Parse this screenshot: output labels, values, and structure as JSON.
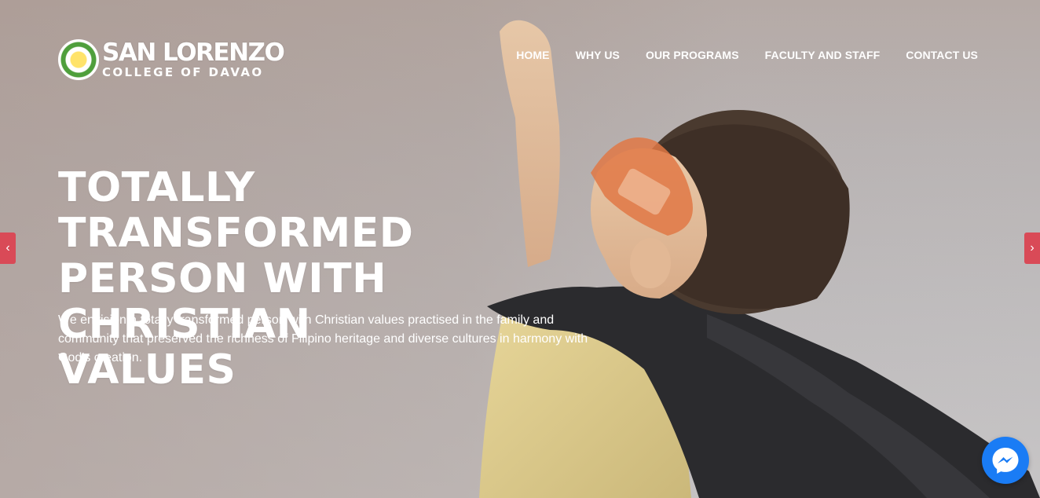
{
  "brand": {
    "line1": "SAN LORENZO",
    "line2": "COLLEGE OF DAVAO"
  },
  "nav": {
    "items": [
      "HOME",
      "WHY US",
      "OUR PROGRAMS",
      "FACULTY AND STAFF",
      "CONTACT US"
    ]
  },
  "hero": {
    "headline_lines": [
      "TOTALLY TRANSFORMED",
      "PERSON WITH CHRISTIAN",
      "VALUES"
    ],
    "subtext": "We envision a totally transformed person with Christian values practised in the family and community that preserved the richness of Filipino heritage and diverse cultures in harmony with God's creation."
  },
  "slider": {
    "prev_icon": "chevron-left-icon",
    "next_icon": "chevron-right-icon",
    "prev_glyph": "‹",
    "next_glyph": "›"
  },
  "chat": {
    "icon": "messenger-icon"
  },
  "colors": {
    "arrow_bg": "#d94a57",
    "messenger_bg": "#1a7cf5",
    "text": "#ffffff"
  }
}
